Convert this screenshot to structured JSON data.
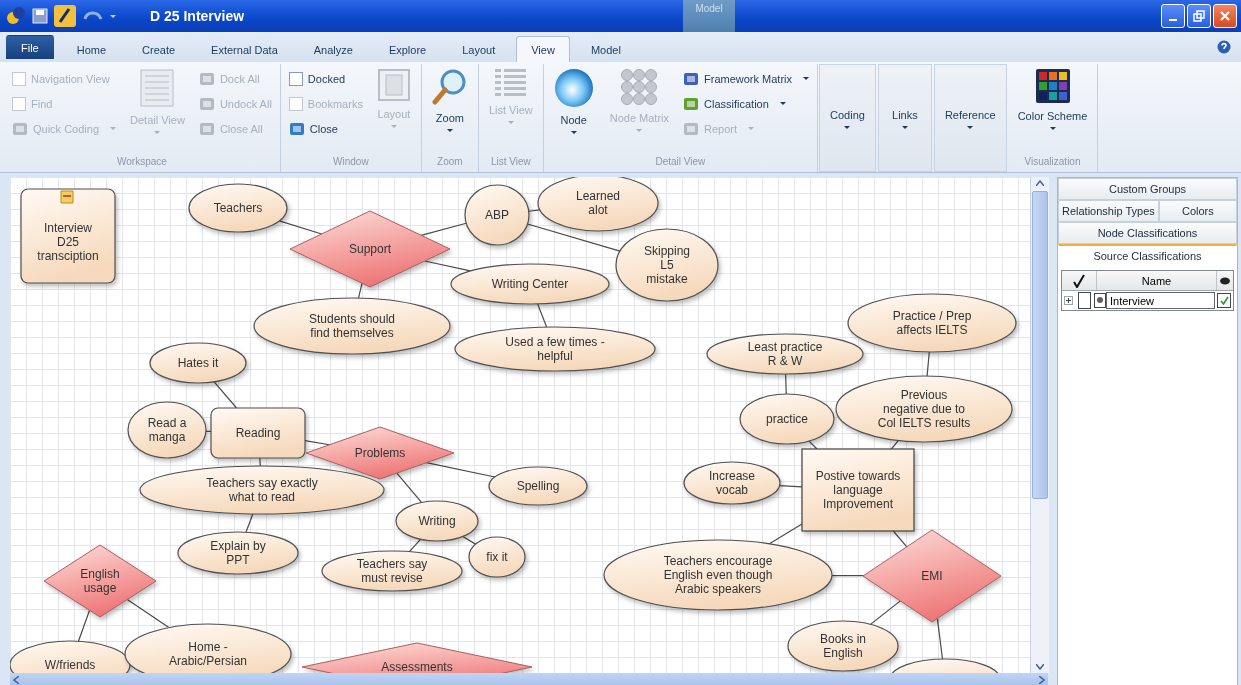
{
  "window": {
    "title": "D 25 Interview",
    "context_tab": "Model"
  },
  "tabs": [
    {
      "label": "File",
      "selected": false,
      "kind": "file"
    },
    {
      "label": "Home",
      "selected": false,
      "kind": "tab"
    },
    {
      "label": "Create",
      "selected": false,
      "kind": "tab"
    },
    {
      "label": "External Data",
      "selected": false,
      "kind": "tab"
    },
    {
      "label": "Analyze",
      "selected": false,
      "kind": "tab"
    },
    {
      "label": "Explore",
      "selected": false,
      "kind": "tab"
    },
    {
      "label": "Layout",
      "selected": false,
      "kind": "tab"
    },
    {
      "label": "View",
      "selected": true,
      "kind": "tab"
    },
    {
      "label": "Model",
      "selected": false,
      "kind": "tab"
    }
  ],
  "ribbon": [
    {
      "label": "Workspace",
      "items": [
        {
          "kind": "check",
          "label": "Navigation View",
          "disabled": true,
          "checked": false
        },
        {
          "kind": "check",
          "label": "Find",
          "disabled": true,
          "checked": false
        },
        {
          "kind": "small",
          "label": "Quick Coding",
          "disabled": true,
          "dropdown": true
        },
        {
          "kind": "large",
          "label": "Detail View",
          "disabled": true,
          "dropdown": true
        },
        {
          "kind": "small",
          "label": "Dock All",
          "disabled": true,
          "dropdown": false
        },
        {
          "kind": "small",
          "label": "Undock All",
          "disabled": true,
          "dropdown": false
        },
        {
          "kind": "small",
          "label": "Close All",
          "disabled": true,
          "dropdown": false
        }
      ]
    },
    {
      "label": "Window",
      "items": [
        {
          "kind": "check",
          "label": "Docked",
          "disabled": false,
          "checked": false
        },
        {
          "kind": "check",
          "label": "Bookmarks",
          "disabled": true,
          "checked": false
        },
        {
          "kind": "small",
          "label": "Close",
          "disabled": false,
          "dropdown": false
        },
        {
          "kind": "large",
          "label": "Layout",
          "disabled": true,
          "dropdown": true
        }
      ]
    },
    {
      "label": "Zoom",
      "items": [
        {
          "kind": "large",
          "label": "Zoom",
          "disabled": false,
          "dropdown": true
        }
      ]
    },
    {
      "label": "List View",
      "items": [
        {
          "kind": "large",
          "label": "List View",
          "disabled": true,
          "dropdown": true
        }
      ]
    },
    {
      "label": "Detail View",
      "items": [
        {
          "kind": "large",
          "label": "Node",
          "disabled": false,
          "dropdown": true
        },
        {
          "kind": "large",
          "label": "Node Matrix",
          "disabled": true,
          "dropdown": true
        },
        {
          "kind": "small",
          "label": "Framework Matrix",
          "disabled": false,
          "dropdown": true
        },
        {
          "kind": "small",
          "label": "Classification",
          "disabled": false,
          "dropdown": true
        },
        {
          "kind": "small",
          "label": "Report",
          "disabled": true,
          "dropdown": true
        }
      ]
    },
    {
      "items": [
        {
          "kind": "large",
          "label": "Coding",
          "disabled": false,
          "dropdown": true
        }
      ]
    },
    {
      "items": [
        {
          "kind": "large",
          "label": "Links",
          "disabled": false,
          "dropdown": true
        }
      ]
    },
    {
      "items": [
        {
          "kind": "large",
          "label": "Reference",
          "disabled": false,
          "dropdown": true
        }
      ]
    },
    {
      "label": "Visualization",
      "items": [
        {
          "kind": "large",
          "label": "Color Scheme",
          "disabled": false,
          "dropdown": true
        }
      ]
    }
  ],
  "diagram": {
    "nodes": [
      {
        "kind": "source",
        "label": "Interview\nD25\ntransciption"
      },
      {
        "kind": "ellipse",
        "label": "Teachers"
      },
      {
        "kind": "diamond",
        "label": "Support"
      },
      {
        "kind": "ellipse",
        "label": "ABP"
      },
      {
        "kind": "ellipse",
        "label": "Learned\nalot"
      },
      {
        "kind": "ellipse",
        "label": "Skipping\nL5\nmistake"
      },
      {
        "kind": "ellipse",
        "label": "Writing Center"
      },
      {
        "kind": "ellipse",
        "label": "Students should\nfind themselves"
      },
      {
        "kind": "ellipse",
        "label": "Used a few times -\nhelpful"
      },
      {
        "kind": "ellipse",
        "label": "Hates it"
      },
      {
        "kind": "ellipse",
        "label": "Read a\nmanga"
      },
      {
        "kind": "card",
        "label": "Reading"
      },
      {
        "kind": "diamond",
        "label": "Problems"
      },
      {
        "kind": "ellipse",
        "label": "Teachers say exactly\nwhat to read"
      },
      {
        "kind": "ellipse",
        "label": "Spelling"
      },
      {
        "kind": "ellipse",
        "label": "Writing"
      },
      {
        "kind": "ellipse",
        "label": "Explain by\nPPT"
      },
      {
        "kind": "ellipse",
        "label": "Teachers say\nmust revise"
      },
      {
        "kind": "ellipse",
        "label": "fix it"
      },
      {
        "kind": "diamond",
        "label": "English\nusage"
      },
      {
        "kind": "ellipse",
        "label": "W/friends"
      },
      {
        "kind": "ellipse",
        "label": "Home -\nArabic/Persian"
      },
      {
        "kind": "diamond",
        "label": "Assessments"
      },
      {
        "kind": "ellipse",
        "label": "Least practice\nR & W"
      },
      {
        "kind": "ellipse",
        "label": "Practice / Prep\naffects IELTS"
      },
      {
        "kind": "ellipse",
        "label": "practice"
      },
      {
        "kind": "ellipse",
        "label": "Previous\nnegative due to\nCol IELTS results"
      },
      {
        "kind": "ellipse",
        "label": "Increase\nvocab"
      },
      {
        "kind": "box",
        "label": "Postive towards\nlanguage\nImprovement"
      },
      {
        "kind": "ellipse",
        "label": "Teachers encourage\nEnglish even though\nArabic speakers"
      },
      {
        "kind": "diamond",
        "label": "EMI"
      },
      {
        "kind": "ellipse",
        "label": "Books in\nEnglish"
      },
      {
        "kind": "ellipse"
      }
    ]
  },
  "side_panel": {
    "tabs": [
      {
        "label": "Custom Groups",
        "selected": false
      },
      {
        "label": "Relationship Types",
        "selected": false
      },
      {
        "label": "Colors",
        "selected": false
      },
      {
        "label": "Node Classifications",
        "selected": false
      },
      {
        "label": "Source Classifications",
        "selected": true
      }
    ],
    "table": {
      "columns": [
        "Name"
      ],
      "rows": [
        {
          "name": "Interview",
          "expanded": false,
          "checked": false,
          "visible": true
        }
      ]
    }
  }
}
